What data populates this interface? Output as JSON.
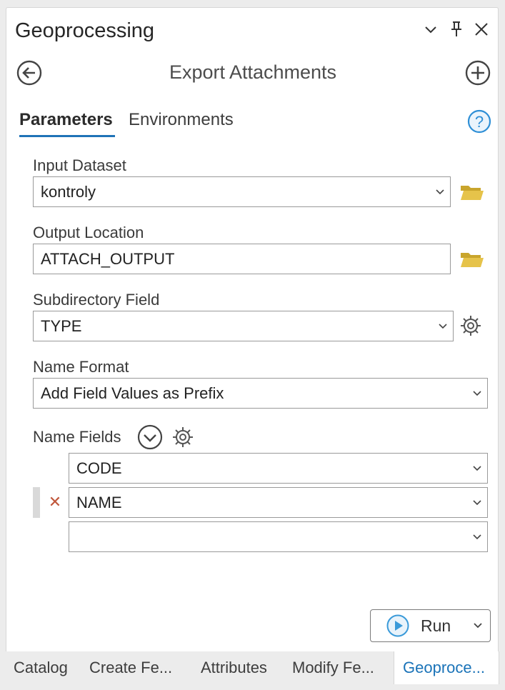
{
  "pane": {
    "title": "Geoprocessing",
    "tool_title": "Export Attachments"
  },
  "tabs": [
    {
      "label": "Parameters",
      "active": true
    },
    {
      "label": "Environments",
      "active": false
    }
  ],
  "params": {
    "input_dataset": {
      "label": "Input Dataset",
      "value": "kontroly"
    },
    "output_location": {
      "label": "Output Location",
      "value": "ATTACH_OUTPUT"
    },
    "subdirectory_field": {
      "label": "Subdirectory Field",
      "value": "TYPE"
    },
    "name_format": {
      "label": "Name Format",
      "value": "Add Field Values as Prefix"
    },
    "name_fields": {
      "label": "Name Fields",
      "rows": [
        "CODE",
        "NAME",
        ""
      ]
    }
  },
  "run": {
    "label": "Run"
  },
  "bottom_tabs": [
    {
      "label": "Catalog",
      "active": false
    },
    {
      "label": "Create Fe...",
      "active": false
    },
    {
      "label": "Attributes",
      "active": false
    },
    {
      "label": "Modify Fe...",
      "active": false
    },
    {
      "label": "Geoproce...",
      "active": true
    }
  ],
  "icons": {
    "options": "chevron-down-icon",
    "pin": "pin-icon",
    "close": "close-icon",
    "back": "back-arrow-icon",
    "add": "plus-icon",
    "help": "help-icon",
    "browse": "folder-icon",
    "settings": "gear-icon",
    "expand": "expand-icon",
    "run": "play-icon"
  },
  "colors": {
    "accent": "#1f73b7",
    "folder": "#e6c34a",
    "remove": "#c0563a",
    "help": "#2e8fd6",
    "run_icon": "#3a9ad9"
  }
}
